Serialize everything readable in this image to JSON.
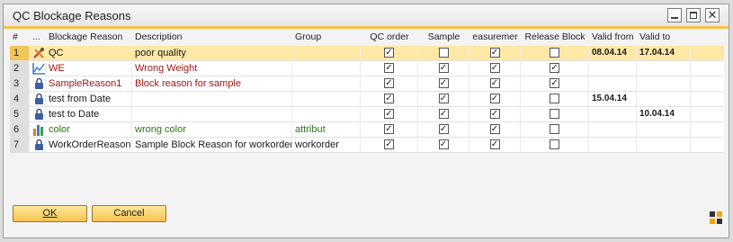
{
  "window": {
    "title": "QC Blockage Reasons"
  },
  "columns": {
    "num": "#",
    "icon": "...",
    "reason": "Blockage Reason",
    "description": "Description",
    "group": "Group",
    "qc_order": "QC order",
    "sample": "Sample",
    "measurement": "easuremer",
    "release_block": "Release Block",
    "valid_from": "Valid from",
    "valid_to": "Valid to"
  },
  "rows": [
    {
      "num": "1",
      "icon": "tools-icon",
      "reason": "QC",
      "description": "poor quality",
      "group": "",
      "qc": true,
      "sample": false,
      "measurement": true,
      "release": false,
      "valid_from": "08.04.14",
      "valid_to": "17.04.14",
      "color": "default"
    },
    {
      "num": "2",
      "icon": "chart-icon",
      "reason": "WE",
      "description": "Wrong Weight",
      "group": "",
      "qc": true,
      "sample": true,
      "measurement": true,
      "release": true,
      "valid_from": "",
      "valid_to": "",
      "color": "red"
    },
    {
      "num": "3",
      "icon": "lock-icon",
      "reason": "SampleReason1",
      "description": "Block reason for sample",
      "group": "",
      "qc": true,
      "sample": true,
      "measurement": true,
      "release": true,
      "valid_from": "",
      "valid_to": "",
      "color": "red"
    },
    {
      "num": "4",
      "icon": "lock-icon",
      "reason": "test from Date",
      "description": "",
      "group": "",
      "qc": true,
      "sample": true,
      "measurement": true,
      "release": false,
      "valid_from": "15.04.14",
      "valid_to": "",
      "color": "default"
    },
    {
      "num": "5",
      "icon": "lock-icon",
      "reason": "test to Date",
      "description": "",
      "group": "",
      "qc": true,
      "sample": true,
      "measurement": true,
      "release": false,
      "valid_from": "",
      "valid_to": "10.04.14",
      "color": "default"
    },
    {
      "num": "6",
      "icon": "bars-icon",
      "reason": "color",
      "description": "wrong color",
      "group": "attribut",
      "qc": true,
      "sample": true,
      "measurement": true,
      "release": false,
      "valid_from": "",
      "valid_to": "",
      "color": "green"
    },
    {
      "num": "7",
      "icon": "lock-icon",
      "reason": "WorkOrderReason",
      "description": "Sample Block Reason for workorder",
      "group": "workorder",
      "qc": true,
      "sample": true,
      "measurement": true,
      "release": false,
      "valid_from": "",
      "valid_to": "",
      "color": "default"
    }
  ],
  "buttons": {
    "ok": "OK",
    "cancel": "Cancel"
  },
  "colors": {
    "accent": "#f6c24a",
    "selected_row": "#fde8a6",
    "red_text": "#a01818",
    "green_text": "#2a7a15"
  }
}
